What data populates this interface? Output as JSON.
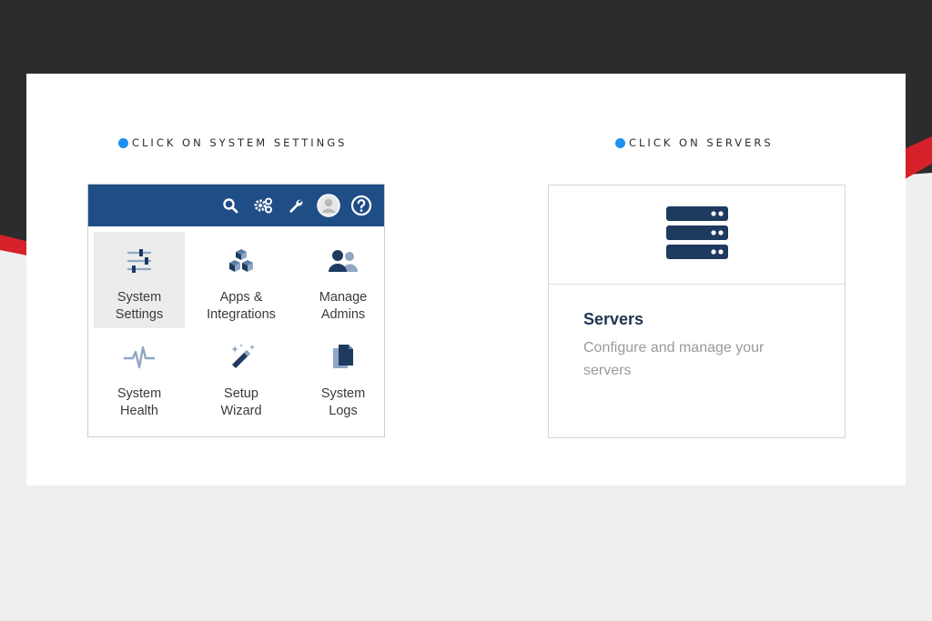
{
  "steps": {
    "left": "CLICK ON SYSTEM SETTINGS",
    "right": "CLICK ON SERVERS"
  },
  "colors": {
    "accent_dot": "#1e90f0",
    "menu_bar": "#1f4d86",
    "icon_navy": "#1e3a5f",
    "icon_light": "#8fa7c4",
    "stripe_red": "#d6202a"
  },
  "toolbar": {
    "icons": [
      "search-icon",
      "gears-icon",
      "wrench-icon",
      "avatar-icon",
      "help-icon"
    ]
  },
  "menu": {
    "items": [
      {
        "line1": "System",
        "line2": "Settings",
        "icon": "sliders-icon",
        "active": true
      },
      {
        "line1": "Apps &",
        "line2": "Integrations",
        "icon": "cubes-icon",
        "active": false
      },
      {
        "line1": "Manage",
        "line2": "Admins",
        "icon": "users-icon",
        "active": false
      },
      {
        "line1": "System",
        "line2": "Health",
        "icon": "pulse-icon",
        "active": false
      },
      {
        "line1": "Setup",
        "line2": "Wizard",
        "icon": "magic-wand-icon",
        "active": false
      },
      {
        "line1": "System",
        "line2": "Logs",
        "icon": "files-icon",
        "active": false
      }
    ]
  },
  "server_card": {
    "icon": "server-stack-icon",
    "title": "Servers",
    "description": "Configure and manage your servers"
  }
}
